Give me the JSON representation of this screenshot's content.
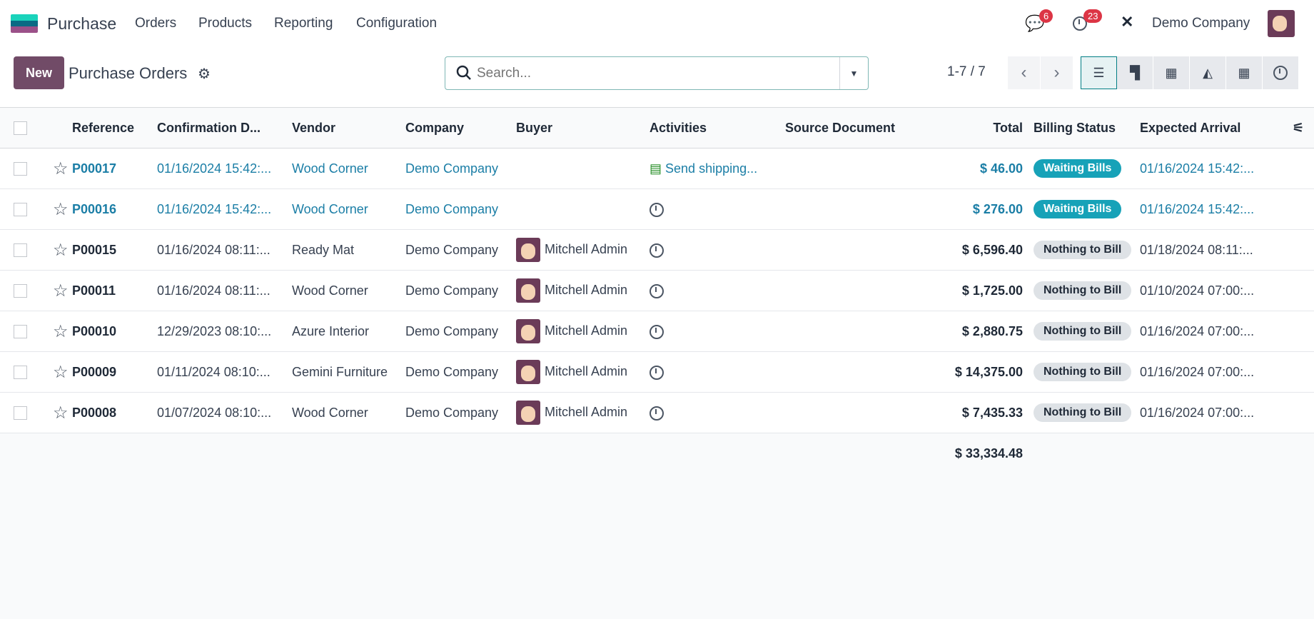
{
  "nav": {
    "app": "Purchase",
    "menus": [
      "Orders",
      "Products",
      "Reporting",
      "Configuration"
    ],
    "messages_count": "6",
    "activities_count": "23",
    "company": "Demo Company"
  },
  "control": {
    "new_label": "New",
    "title": "Purchase Orders",
    "search_placeholder": "Search...",
    "pager": "1-7 / 7"
  },
  "columns": [
    "Reference",
    "Confirmation D...",
    "Vendor",
    "Company",
    "Buyer",
    "Activities",
    "Source Document",
    "Total",
    "Billing Status",
    "Expected Arrival"
  ],
  "rows": [
    {
      "ref": "P00017",
      "date": "01/16/2024 15:42:...",
      "vendor": "Wood Corner",
      "company": "Demo Company",
      "buyer": "",
      "activity": "Send shipping...",
      "source": "",
      "total": "$ 46.00",
      "billing": "Waiting Bills",
      "arrival": "01/16/2024 15:42:...",
      "highlight": true
    },
    {
      "ref": "P00016",
      "date": "01/16/2024 15:42:...",
      "vendor": "Wood Corner",
      "company": "Demo Company",
      "buyer": "",
      "activity": "",
      "source": "",
      "total": "$ 276.00",
      "billing": "Waiting Bills",
      "arrival": "01/16/2024 15:42:...",
      "highlight": true
    },
    {
      "ref": "P00015",
      "date": "01/16/2024 08:11:...",
      "vendor": "Ready Mat",
      "company": "Demo Company",
      "buyer": "Mitchell Admin",
      "activity": "",
      "source": "",
      "total": "$ 6,596.40",
      "billing": "Nothing to Bill",
      "arrival": "01/18/2024 08:11:..."
    },
    {
      "ref": "P00011",
      "date": "01/16/2024 08:11:...",
      "vendor": "Wood Corner",
      "company": "Demo Company",
      "buyer": "Mitchell Admin",
      "activity": "",
      "source": "",
      "total": "$ 1,725.00",
      "billing": "Nothing to Bill",
      "arrival": "01/10/2024 07:00:..."
    },
    {
      "ref": "P00010",
      "date": "12/29/2023 08:10:...",
      "vendor": "Azure Interior",
      "company": "Demo Company",
      "buyer": "Mitchell Admin",
      "activity": "",
      "source": "",
      "total": "$ 2,880.75",
      "billing": "Nothing to Bill",
      "arrival": "01/16/2024 07:00:..."
    },
    {
      "ref": "P00009",
      "date": "01/11/2024 08:10:...",
      "vendor": "Gemini Furniture",
      "company": "Demo Company",
      "buyer": "Mitchell Admin",
      "activity": "",
      "source": "",
      "total": "$ 14,375.00",
      "billing": "Nothing to Bill",
      "arrival": "01/16/2024 07:00:..."
    },
    {
      "ref": "P00008",
      "date": "01/07/2024 08:10:...",
      "vendor": "Wood Corner",
      "company": "Demo Company",
      "buyer": "Mitchell Admin",
      "activity": "",
      "source": "",
      "total": "$ 7,435.33",
      "billing": "Nothing to Bill",
      "arrival": "01/16/2024 07:00:..."
    }
  ],
  "grand_total": "$ 33,334.48"
}
